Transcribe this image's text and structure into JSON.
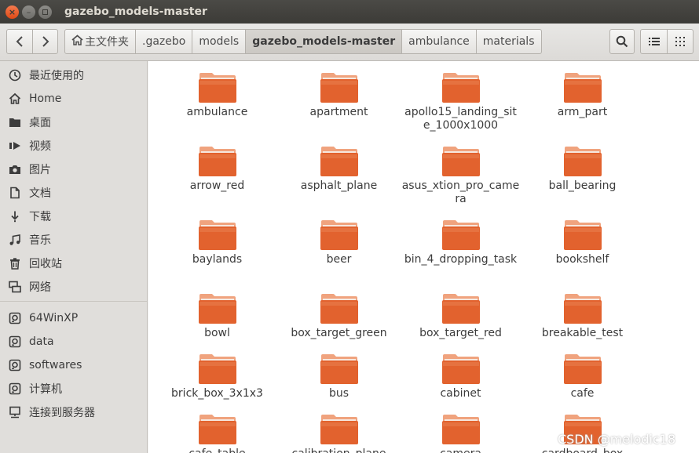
{
  "window": {
    "title": "gazebo_models-master"
  },
  "toolbar": {
    "back_glyph": "‹",
    "forward_glyph": "›",
    "home_glyph": "⌂",
    "breadcrumbs": [
      {
        "label": "主文件夹"
      },
      {
        "label": ".gazebo"
      },
      {
        "label": "models"
      },
      {
        "label": "gazebo_models-master"
      },
      {
        "label": "ambulance"
      },
      {
        "label": "materials"
      }
    ],
    "active_crumb": "gazebo_models-master"
  },
  "sidebar": {
    "places": [
      {
        "label": "最近使用的",
        "icon": "clock-icon"
      },
      {
        "label": "Home",
        "icon": "home-icon"
      },
      {
        "label": "桌面",
        "icon": "desktop-folder-icon"
      },
      {
        "label": "视频",
        "icon": "video-icon"
      },
      {
        "label": "图片",
        "icon": "camera-icon"
      },
      {
        "label": "文档",
        "icon": "document-icon"
      },
      {
        "label": "下载",
        "icon": "download-icon"
      },
      {
        "label": "音乐",
        "icon": "music-icon"
      },
      {
        "label": "回收站",
        "icon": "trash-icon"
      },
      {
        "label": "网络",
        "icon": "network-icon"
      }
    ],
    "devices": [
      {
        "label": "64WinXP",
        "icon": "drive-icon"
      },
      {
        "label": "data",
        "icon": "drive-icon"
      },
      {
        "label": "softwares",
        "icon": "drive-icon"
      },
      {
        "label": "计算机",
        "icon": "drive-icon"
      },
      {
        "label": "连接到服务器",
        "icon": "server-icon"
      }
    ]
  },
  "files": [
    {
      "name": "ambulance"
    },
    {
      "name": "apartment"
    },
    {
      "name": "apollo15_landing_site_1000x1000"
    },
    {
      "name": "arm_part"
    },
    {
      "name": "arrow_red"
    },
    {
      "name": "asphalt_plane"
    },
    {
      "name": "asus_xtion_pro_camera"
    },
    {
      "name": "ball_bearing"
    },
    {
      "name": "baylands"
    },
    {
      "name": "beer"
    },
    {
      "name": "bin_4_dropping_task"
    },
    {
      "name": "bookshelf"
    },
    {
      "name": "bowl"
    },
    {
      "name": "box_target_green"
    },
    {
      "name": "box_target_red"
    },
    {
      "name": "breakable_test"
    },
    {
      "name": "brick_box_3x1x3"
    },
    {
      "name": "bus"
    },
    {
      "name": "cabinet"
    },
    {
      "name": "cafe"
    },
    {
      "name": "cafe_table"
    },
    {
      "name": "calibration_plane"
    },
    {
      "name": "camera"
    },
    {
      "name": "cardboard_box"
    }
  ],
  "colors": {
    "folder_front": "#e2622e",
    "folder_back": "#f0a37e",
    "title_bar": "#3c3b37",
    "close_button": "#e9571f"
  },
  "watermark": "CSDN @melodic18"
}
